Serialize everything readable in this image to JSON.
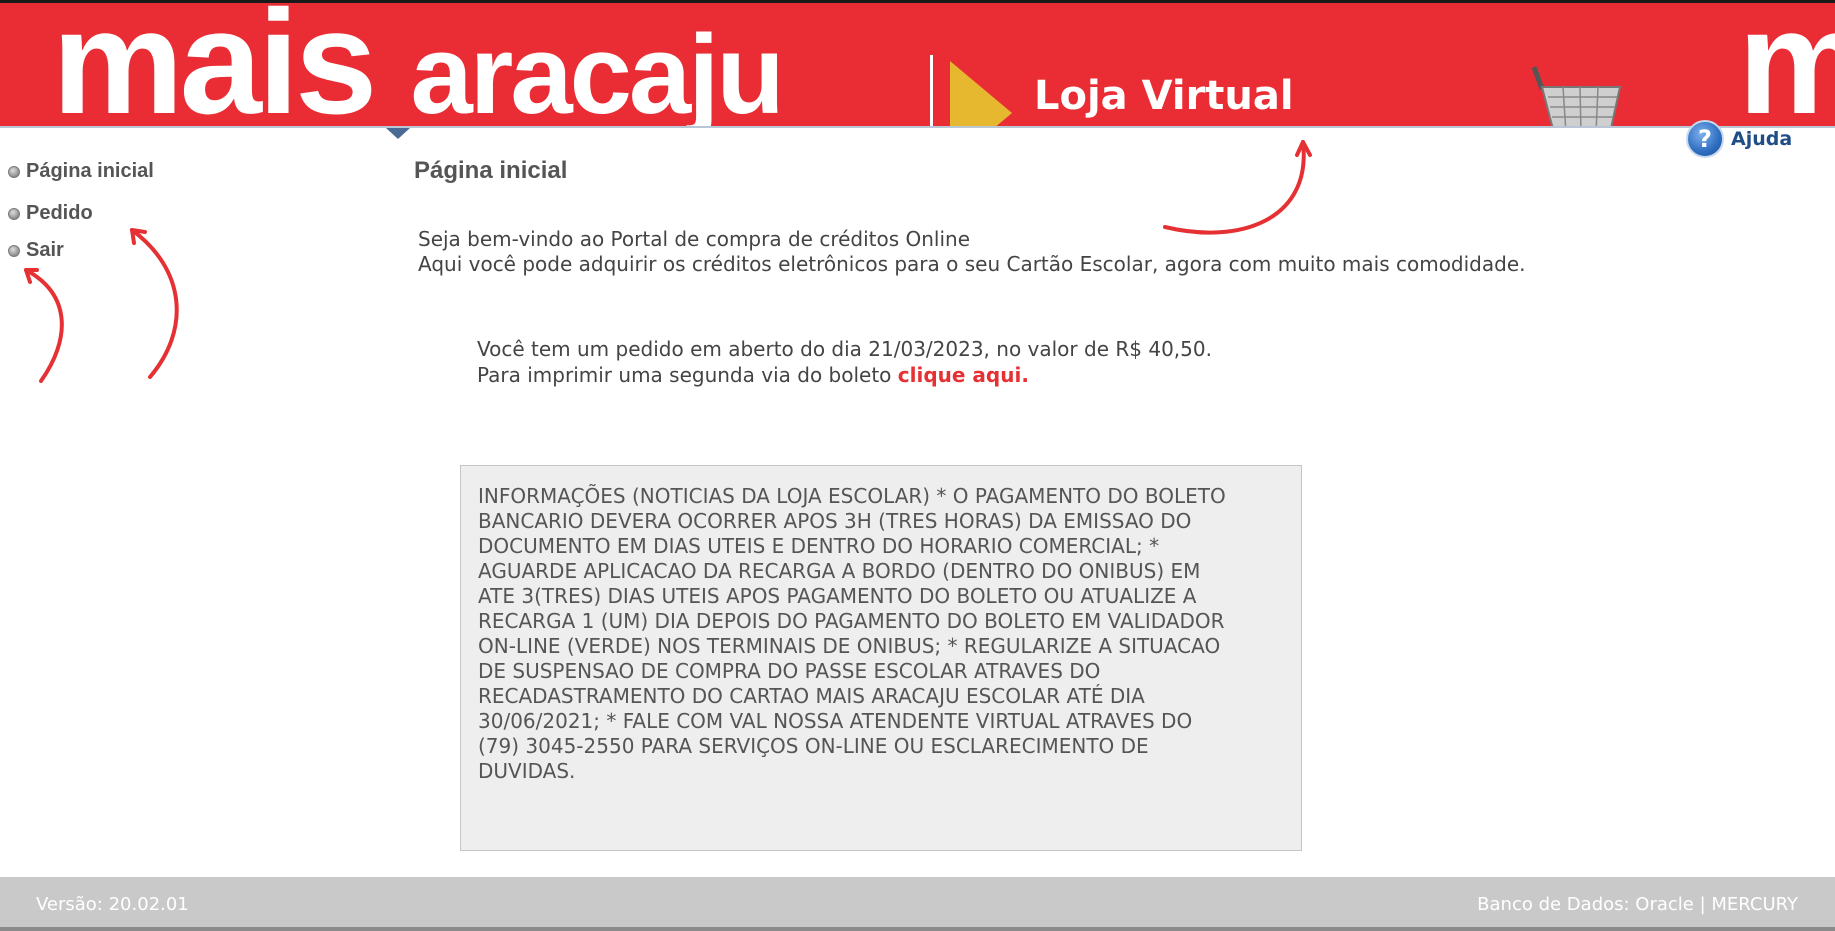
{
  "header": {
    "logo_main": "mais",
    "logo_sub": "aracaju",
    "logo_right": "m",
    "loja_label": "Loja Virtual",
    "colors": {
      "banner": "#ea2d34",
      "triangle": "#e6b830"
    }
  },
  "help": {
    "icon": "question-icon",
    "glyph": "?",
    "label": "Ajuda"
  },
  "sidebar": {
    "items": [
      {
        "label": "Página inicial"
      },
      {
        "label": "Pedido"
      },
      {
        "label": "Sair"
      }
    ]
  },
  "main": {
    "title": "Página inicial",
    "welcome_line1": "Seja bem-vindo ao Portal de compra de créditos Online",
    "welcome_line2": "Aqui você pode adquirir os créditos eletrônicos para o seu Cartão Escolar, agora com muito mais comodidade.",
    "order_line1": "Você tem um pedido em aberto do dia 21/03/2023, no valor de R$ 40,50.",
    "order_line2": "Para imprimir uma segunda via do boleto",
    "order_link": "clique aqui.",
    "info_text": "INFORMAÇÕES (NOTICIAS DA LOJA ESCOLAR) * O PAGAMENTO DO BOLETO BANCARIO DEVERA OCORRER APOS 3H (TRES HORAS) DA EMISSAO DO DOCUMENTO EM DIAS UTEIS E DENTRO DO HORARIO COMERCIAL; * AGUARDE APLICACAO DA RECARGA A BORDO (DENTRO DO ONIBUS) EM ATE 3(TRES) DIAS UTEIS APOS PAGAMENTO DO BOLETO OU ATUALIZE A RECARGA 1 (UM) DIA DEPOIS DO PAGAMENTO DO BOLETO EM VALIDADOR ON-LINE (VERDE) NOS TERMINAIS DE ONIBUS; * REGULARIZE A SITUACAO DE SUSPENSAO DE COMPRA DO PASSE ESCOLAR ATRAVES DO RECADASTRAMENTO DO CARTAO MAIS ARACAJU ESCOLAR ATÉ DIA 30/06/2021; * FALE COM VAL NOSSA ATENDENTE VIRTUAL ATRAVES DO (79) 3045-2550 PARA SERVIÇOS ON-LINE OU ESCLARECIMENTO DE DUVIDAS."
  },
  "footer": {
    "version": "Versão: 20.02.01",
    "database": "Banco de Dados: Oracle | MERCURY"
  },
  "annotations": {
    "arrow_color": "#e53134"
  }
}
